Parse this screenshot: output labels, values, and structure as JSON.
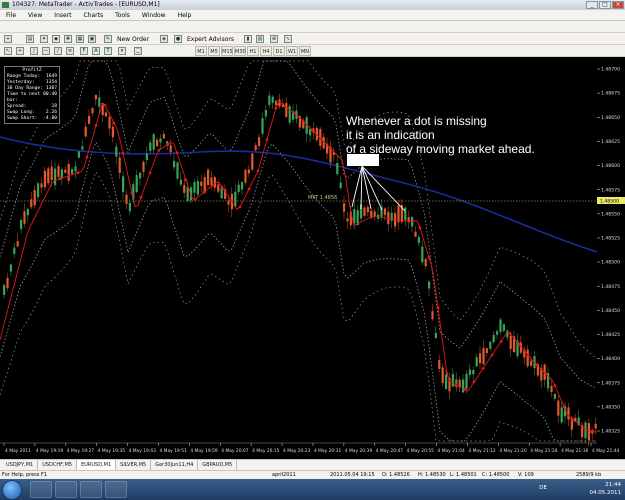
{
  "window": {
    "title": "104327: MetaTrader - ActivTrades - [EURUSD,M1]",
    "buttons": [
      "_",
      "□",
      "×"
    ]
  },
  "menu": [
    "File",
    "View",
    "Insert",
    "Charts",
    "Tools",
    "Window",
    "Help"
  ],
  "toolbar": {
    "new_order": "New Order",
    "expert_advisors": "Expert Advisors",
    "periods": [
      "M1",
      "M5",
      "M15",
      "M30",
      "H1",
      "H4",
      "D1",
      "W1",
      "MN"
    ],
    "active_period": "M1"
  },
  "info_panel": {
    "title": "ProfitZ",
    "rows": [
      [
        "Range Today:",
        "1649"
      ],
      [
        "Yesterday:",
        "1354"
      ],
      [
        "30 Day Range:",
        "1307"
      ],
      [
        "Time to next bar:",
        "00:40"
      ],
      [
        "Spread:",
        "18"
      ],
      [
        "Swap Long:",
        "2.26"
      ],
      [
        "Swap Short:",
        "-4.80"
      ]
    ]
  },
  "annotation": {
    "line1": "Whenever a dot is missing",
    "line2": "it is an indication",
    "line3": "of a sideway moving market ahead."
  },
  "chart": {
    "symbol": "EURUSD",
    "timeframe": "M1",
    "price_marker": "MKT 1.4856",
    "current_price": "1.48500",
    "price_scale": [
      "1.48700",
      "1.48675",
      "1.48650",
      "1.48625",
      "1.48600",
      "1.48575",
      "1.48550",
      "1.48525",
      "1.48500",
      "1.48475",
      "1.48450",
      "1.48425",
      "1.48400",
      "1.48375",
      "1.48350",
      "1.48325"
    ],
    "time_scale": [
      "4 May 2011",
      "4 May 19:19",
      "4 May 19:27",
      "4 May 19:35",
      "4 May 19:43",
      "4 May 19:51",
      "4 May 19:59",
      "4 May 20:07",
      "4 May 20:15",
      "4 May 20:23",
      "4 May 20:31",
      "4 May 20:39",
      "4 May 20:47",
      "4 May 20:55",
      "4 May 21:04",
      "4 May 21:12",
      "4 May 21:20",
      "4 May 21:28",
      "4 May 21:36",
      "4 May 21:44"
    ],
    "colors": {
      "bull": "#3aa35a",
      "bear": "#e05a2a",
      "moving_average": "#1a2a9a",
      "bands": "#9a9a9a",
      "dots": "#e01818",
      "price_line": "#c8c880"
    }
  },
  "symbol_tabs": [
    "USDJPY,M1",
    "USDCHF,M5",
    "EURUSD,M1",
    "SILVER,M5",
    "Ger30Jun11,H4",
    "GBPAUD,M5"
  ],
  "active_symbol_tab": "EURUSD,M1",
  "statusbar": {
    "help": "For Help, press F1",
    "profile": "april2011",
    "datetime": "2011.05.04 19:15",
    "open": "O: 1.48526",
    "high": "H: 1.48530",
    "low": "L: 1.48501",
    "close": "C: 1.48500",
    "volume": "V: 109",
    "traffic": "2589/9 kb"
  },
  "taskbar": {
    "language": "DE",
    "time": "21:44",
    "date": "04.05.2011"
  }
}
